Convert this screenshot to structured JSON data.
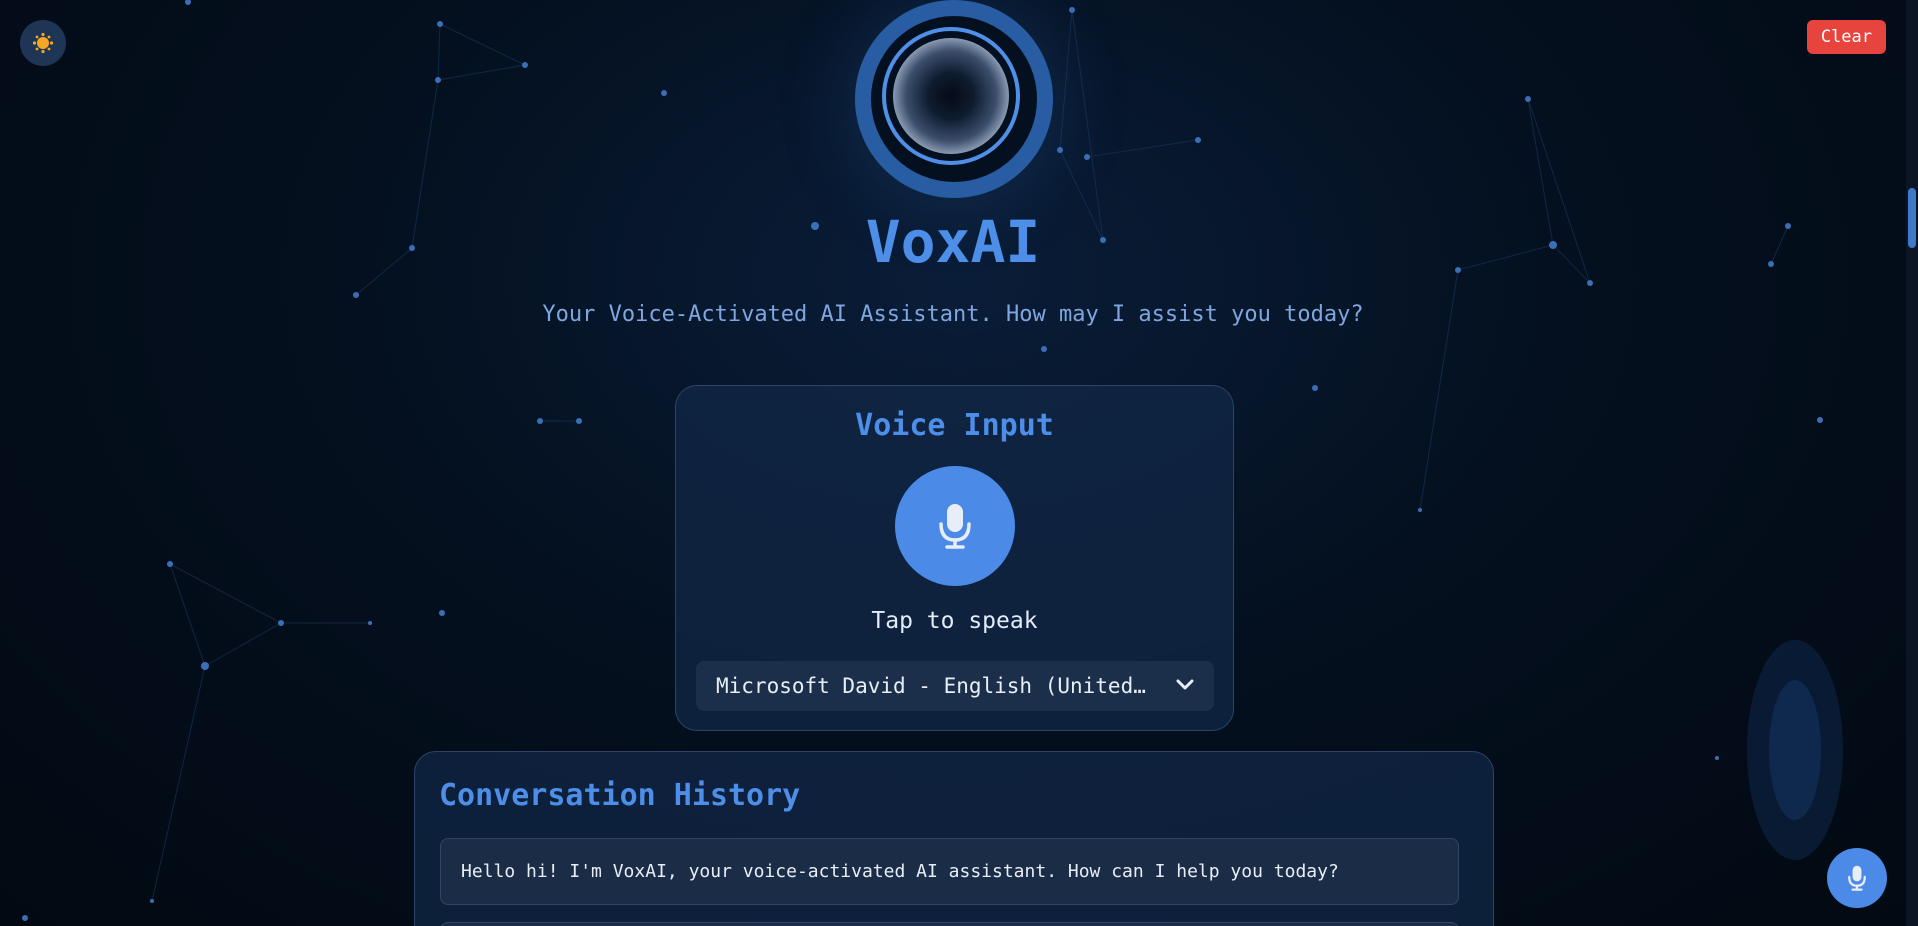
{
  "header": {
    "clear_label": "Clear",
    "theme_icon": "sun-icon"
  },
  "hero": {
    "title": "VoxAI",
    "subtitle": "Your Voice-Activated AI Assistant. How may I assist you today?"
  },
  "voice_input": {
    "title": "Voice Input",
    "mic_icon": "microphone-icon",
    "tap_label": "Tap to speak",
    "selected_voice": "Microsoft David - English (United States)"
  },
  "history": {
    "title": "Conversation History",
    "messages": [
      "Hello hi! I'm VoxAI, your voice-activated AI assistant. How can I help you today?"
    ]
  },
  "colors": {
    "accent": "#4b8ae6",
    "clear_button": "#e8443e",
    "background": "#020a16"
  }
}
